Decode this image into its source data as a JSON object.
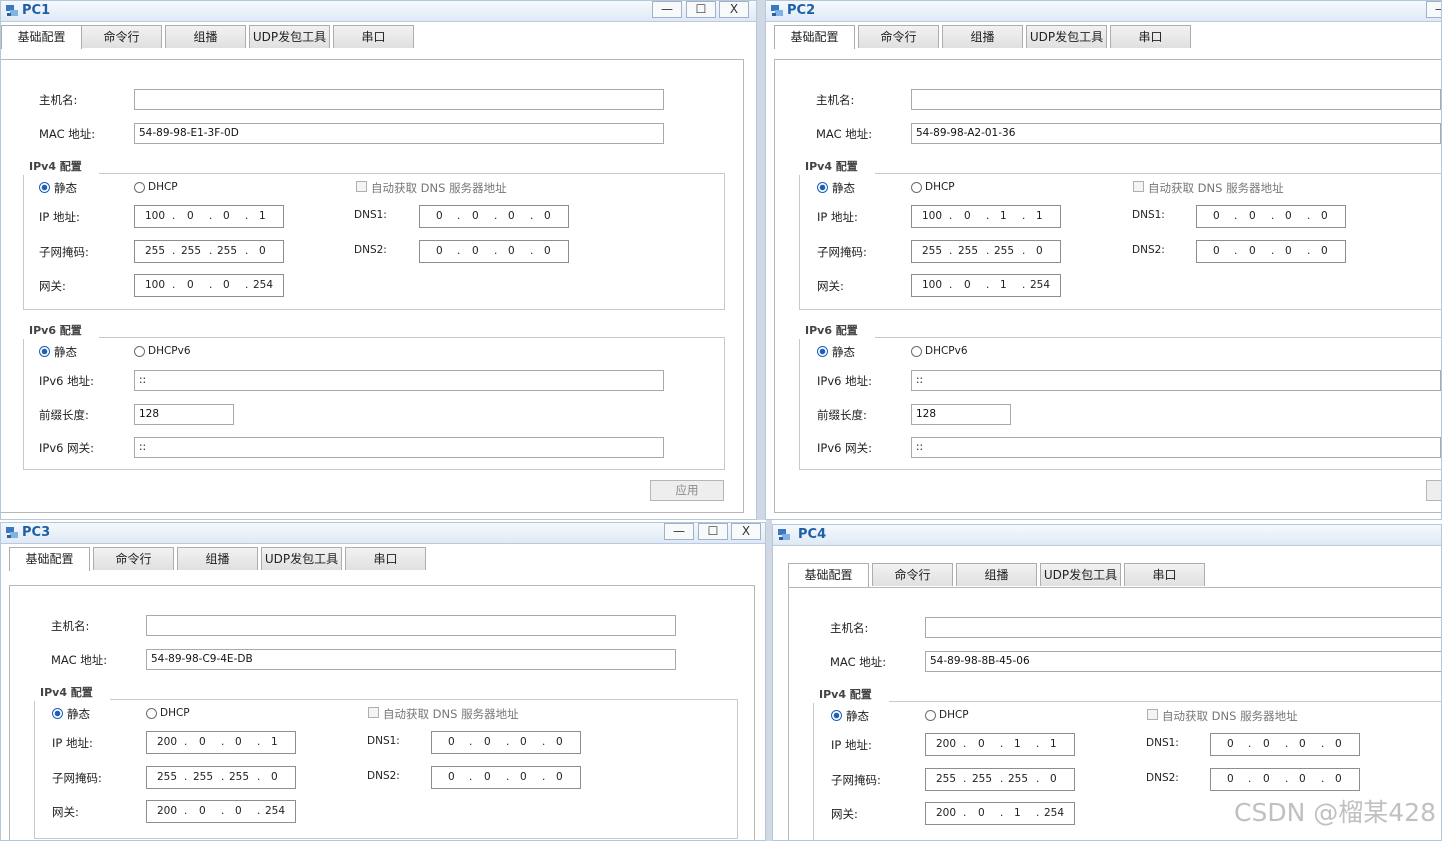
{
  "tabs": [
    "基础配置",
    "命令行",
    "组播",
    "UDP发包工具",
    "串口"
  ],
  "labels": {
    "hostname": "主机名:",
    "mac": "MAC 地址:",
    "ipv4_group": "IPv4 配置",
    "static": "静态",
    "dhcp": "DHCP",
    "auto_dns": "自动获取 DNS 服务器地址",
    "ip": "IP 地址:",
    "dns1": "DNS1:",
    "mask": "子网掩码:",
    "dns2": "DNS2:",
    "gateway": "网关:",
    "ipv6_group": "IPv6 配置",
    "dhcpv6": "DHCPv6",
    "ipv6_addr": "IPv6 地址:",
    "prefix": "前缀长度:",
    "ipv6_gw": "IPv6 网关:",
    "apply": "应用"
  },
  "window_controls": {
    "minimize": "—",
    "maximize": "☐",
    "close": "X"
  },
  "pcs": [
    {
      "title": "PC1",
      "hostname": "",
      "mac": "54-89-98-E1-3F-0D",
      "ip": [
        "100",
        "0",
        "0",
        "1"
      ],
      "mask": [
        "255",
        "255",
        "255",
        "0"
      ],
      "gateway": [
        "100",
        "0",
        "0",
        "254"
      ],
      "dns1": [
        "0",
        "0",
        "0",
        "0"
      ],
      "dns2": [
        "0",
        "0",
        "0",
        "0"
      ],
      "ipv6_addr": "::",
      "prefix": "128",
      "ipv6_gw": "::"
    },
    {
      "title": "PC2",
      "hostname": "",
      "mac": "54-89-98-A2-01-36",
      "ip": [
        "100",
        "0",
        "1",
        "1"
      ],
      "mask": [
        "255",
        "255",
        "255",
        "0"
      ],
      "gateway": [
        "100",
        "0",
        "1",
        "254"
      ],
      "dns1": [
        "0",
        "0",
        "0",
        "0"
      ],
      "dns2": [
        "0",
        "0",
        "0",
        "0"
      ],
      "ipv6_addr": "::",
      "prefix": "128",
      "ipv6_gw": "::"
    },
    {
      "title": "PC3",
      "hostname": "",
      "mac": "54-89-98-C9-4E-DB",
      "ip": [
        "200",
        "0",
        "0",
        "1"
      ],
      "mask": [
        "255",
        "255",
        "255",
        "0"
      ],
      "gateway": [
        "200",
        "0",
        "0",
        "254"
      ],
      "dns1": [
        "0",
        "0",
        "0",
        "0"
      ],
      "dns2": [
        "0",
        "0",
        "0",
        "0"
      ]
    },
    {
      "title": "PC4",
      "hostname": "",
      "mac": "54-89-98-8B-45-06",
      "ip": [
        "200",
        "0",
        "1",
        "1"
      ],
      "mask": [
        "255",
        "255",
        "255",
        "0"
      ],
      "gateway": [
        "200",
        "0",
        "1",
        "254"
      ],
      "dns1": [
        "0",
        "0",
        "0",
        "0"
      ],
      "dns2": [
        "0",
        "0",
        "0",
        "0"
      ]
    }
  ],
  "watermark": "CSDN @榴某428",
  "colors": {
    "title": "#1f5fa8",
    "radio_selected": "#1b5fb8",
    "titlebar_bg": "#dfe9f4"
  }
}
